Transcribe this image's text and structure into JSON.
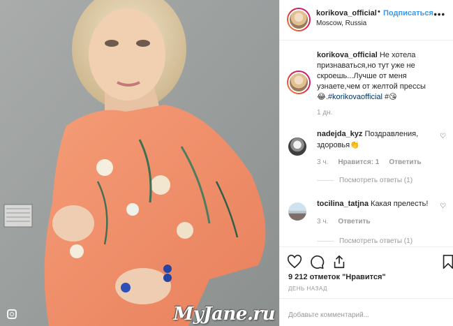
{
  "post": {
    "username": "korikova_official",
    "follow_label": "Подписаться",
    "dot": "•",
    "location": "Moscow, Russia",
    "more": "•••"
  },
  "caption": {
    "username": "korikova_official",
    "text_1": "Не хотела признаваться,но тут уже не скроешь...Лучше от меня узнаете,чем от желтой прессы 😂.",
    "hashtag": "#korikovaofficial",
    "text_2": " #😘",
    "time": "1 дн."
  },
  "comments": [
    {
      "username": "nadejda_kyz",
      "text": "Поздравления, здоровья👏",
      "time": "3 ч.",
      "likes": "Нравится: 1",
      "reply": "Ответить",
      "view_replies": "Посмотреть ответы (1)"
    },
    {
      "username": "tocilina_tatjna",
      "text": "Какая прелесть!",
      "time": "3 ч.",
      "reply": "Ответить",
      "view_replies": "Посмотреть ответы (1)"
    }
  ],
  "icons": {
    "heart": "heart-icon",
    "comment": "comment-icon",
    "share": "share-icon",
    "bookmark": "bookmark-icon",
    "small_heart": "♡"
  },
  "stats": {
    "likes_count": "9 212 отметок",
    "likes_label": "\"Нравится\"",
    "date": "ДЕНЬ НАЗАД"
  },
  "add_comment": {
    "placeholder": "Добавьте комментарий..."
  },
  "watermark": "MyJane.ru",
  "colors": {
    "accent": "#3897f0",
    "hashtag": "#003569",
    "muted": "#999999",
    "dress": "#f0926c"
  }
}
